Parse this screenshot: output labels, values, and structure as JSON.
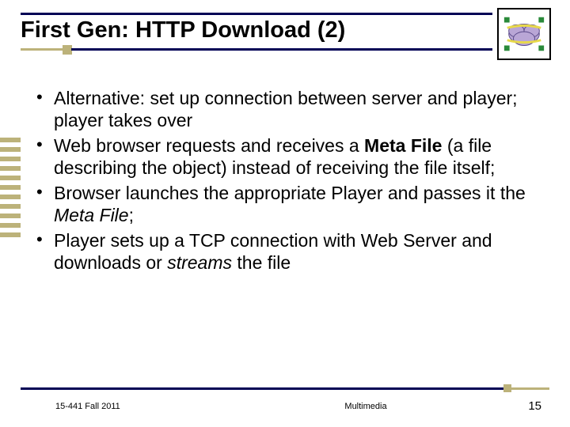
{
  "title": "First Gen: HTTP Download (2)",
  "bullets": [
    {
      "pre": "Alternative: set up connection between server and player; player takes over",
      "bold": "",
      "post": ""
    },
    {
      "pre": "Web browser requests and receives a ",
      "bold": "Meta File",
      "post": " (a file describing the object) instead of receiving the file itself;"
    },
    {
      "pre": "Browser launches the appropriate Player and passes it the ",
      "italic": "Meta File",
      "post": ";"
    },
    {
      "pre": "Player sets up a TCP connection with Web Server and downloads or ",
      "italic": "streams",
      "post": " the file"
    }
  ],
  "footer": {
    "left": "15-441 Fall 2011",
    "center": "Multimedia",
    "right": "15"
  },
  "icon": "cloud-network-icon"
}
